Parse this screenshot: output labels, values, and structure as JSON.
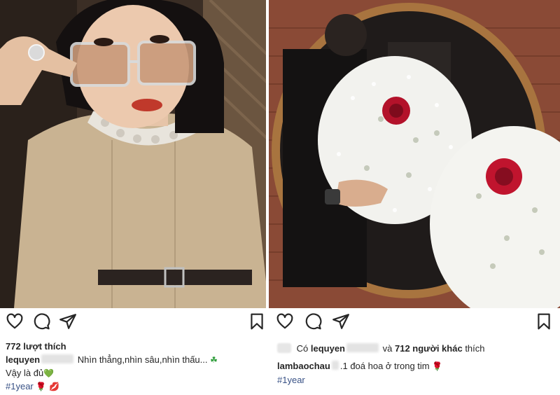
{
  "left_post": {
    "likes": "772 lượt thích",
    "username": "lequyen",
    "caption": "Nhìn thẳng,nhìn sâu,nhìn thấu...",
    "caption_emoji": "☘",
    "line2": "Vậy là đủ",
    "line2_emoji": "💚",
    "hashtag": "#1year",
    "hashtag_emoji_1": "🌹",
    "hashtag_emoji_2": "💋"
  },
  "right_post": {
    "liked_by_prefix": "Có",
    "liked_by_user": "lequyen",
    "liked_by_and": "và",
    "liked_by_others": "712 người khác",
    "liked_by_suffix": "thích",
    "username": "lambaochau",
    "caption": ".1 đoá hoa ở trong tim",
    "caption_emoji": "🌹",
    "hashtag": "#1year"
  },
  "icons": [
    "heart-icon",
    "comment-icon",
    "share-icon",
    "bookmark-icon"
  ],
  "colors": {
    "text": "#262626",
    "hashtag": "#385185",
    "rose": "#c8102e"
  }
}
